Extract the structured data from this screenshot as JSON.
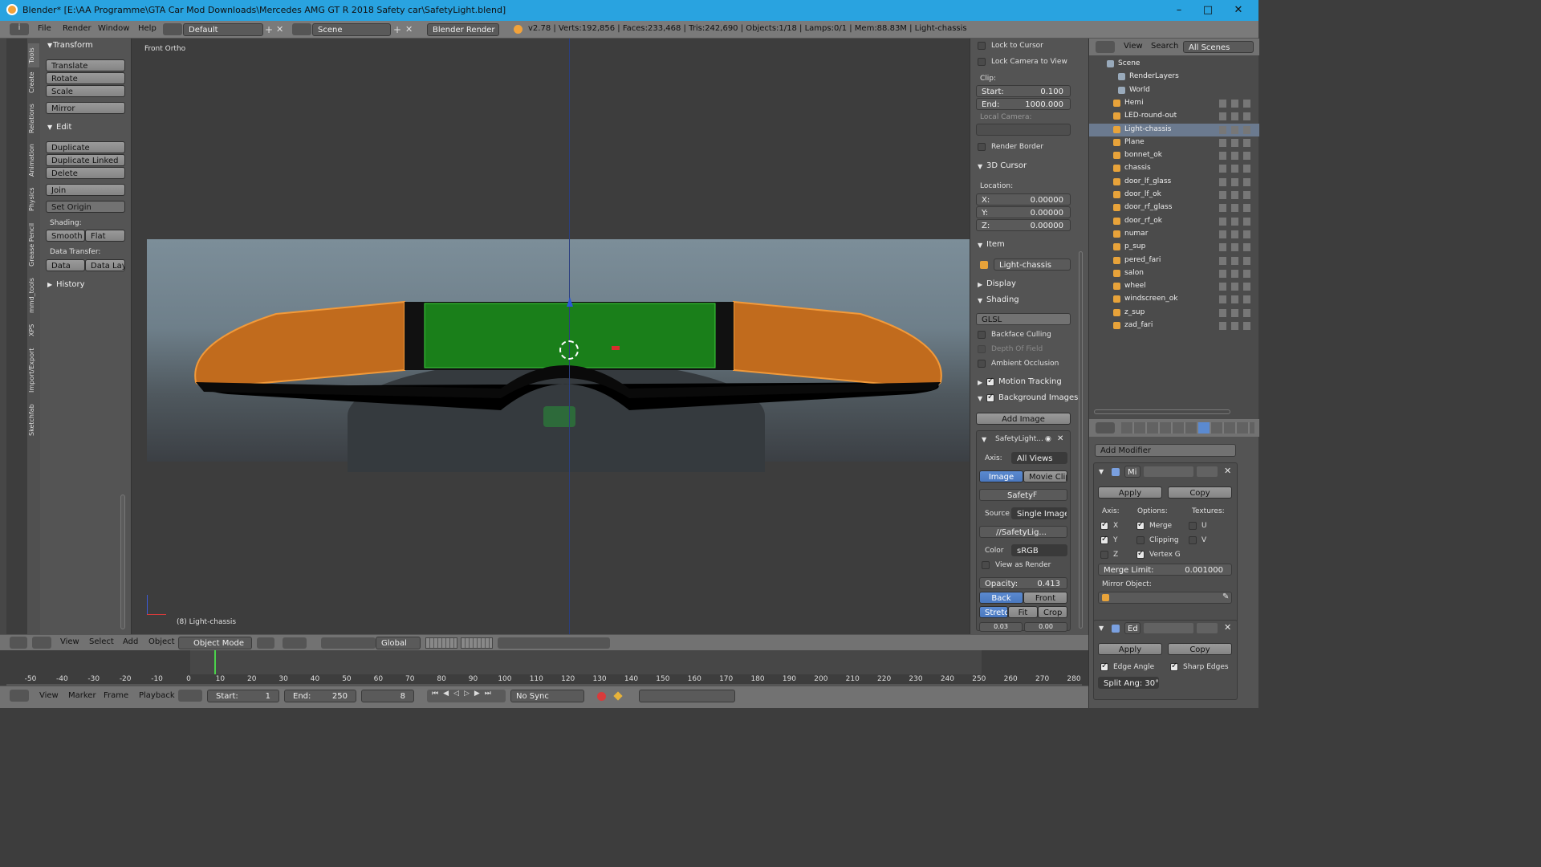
{
  "window": {
    "title": "Blender* [E:\\AA Programme\\GTA Car Mod Downloads\\Mercedes AMG GT R 2018 Safety car\\SafetyLight.blend]",
    "min": "–",
    "max": "□",
    "close": "✕"
  },
  "menubar": {
    "menus": [
      "File",
      "Render",
      "Window",
      "Help"
    ],
    "screen": "Default",
    "scene": "Scene",
    "engine": "Blender Render",
    "stats": "v2.78 | Verts:192,856 | Faces:233,468 | Tris:242,690 | Objects:1/18 | Lamps:0/1 | Mem:88.83M | Light-chassis"
  },
  "tool_tabs": [
    "Tools",
    "Create",
    "Relations",
    "Animation",
    "Physics",
    "Grease Pencil",
    "mmd_tools",
    "XPS",
    "Import/Export",
    "Sketchfab"
  ],
  "tools": {
    "transform_header": "Transform",
    "translate": "Translate",
    "rotate": "Rotate",
    "scale": "Scale",
    "mirror": "Mirror",
    "edit_header": "Edit",
    "duplicate": "Duplicate",
    "duplicate_linked": "Duplicate Linked",
    "delete": "Delete",
    "join": "Join",
    "set_origin": "Set Origin",
    "shading_label": "Shading:",
    "smooth": "Smooth",
    "flat": "Flat",
    "data_transfer_label": "Data Transfer:",
    "data": "Data",
    "data_layout": "Data Layo",
    "history_header": "History"
  },
  "viewport": {
    "view_label": "Front Ortho",
    "object_label": "(8) Light-chassis"
  },
  "view_header": {
    "menus": [
      "View",
      "Select",
      "Add",
      "Object"
    ],
    "mode": "Object Mode",
    "orientation": "Global"
  },
  "npanel": {
    "lock_cursor": "Lock to Cursor",
    "lock_camera": "Lock Camera to View",
    "clip_label": "Clip:",
    "clip_start": "Start:",
    "clip_start_val": "0.100",
    "clip_end": "End:",
    "clip_end_val": "1000.000",
    "local_camera": "Local Camera:",
    "render_border": "Render Border",
    "cursor_header": "3D Cursor",
    "location_label": "Location:",
    "x": "X:",
    "x_val": "0.00000",
    "y": "Y:",
    "y_val": "0.00000",
    "z": "Z:",
    "z_val": "0.00000",
    "item_header": "Item",
    "item_name": "Light-chassis",
    "display_header": "Display",
    "shading_header": "Shading",
    "shading_mode": "GLSL",
    "backface": "Backface Culling",
    "depth_of_field": "Depth Of Field",
    "ambient_occlusion": "Ambient Occlusion",
    "motion_tracking": "Motion Tracking",
    "background_images": "Background Images",
    "add_image": "Add Image",
    "bg_name": "SafetyLight...",
    "axis_label": "Axis:",
    "axis_val": "All Views",
    "image_tab": "Image",
    "movieclip_tab": "Movie Clip",
    "img_name": "Safety",
    "img_f": "F",
    "source_label": "Source",
    "source_val": "Single Image",
    "filepath": "//SafetyLig...",
    "color_label": "Color",
    "color_val": "sRGB",
    "view_as_render": "View as Render",
    "opacity_label": "Opacity:",
    "opacity_val": "0.413",
    "back": "Back",
    "front": "Front",
    "stretch": "Stretch",
    "fit": "Fit",
    "crop": "Crop",
    "off1": "0.03",
    "off2": "0.00"
  },
  "outliner": {
    "view": "View",
    "search": "Search",
    "scenes": "All Scenes",
    "items": [
      "Scene",
      "RenderLayers",
      "World",
      "Hemi",
      "LED-round-out",
      "Light-chassis",
      "Plane",
      "bonnet_ok",
      "chassis",
      "door_lf_glass",
      "door_lf_ok",
      "door_rf_glass",
      "door_rf_ok",
      "numar",
      "p_sup",
      "pered_fari",
      "salon",
      "wheel",
      "windscreen_ok",
      "z_sup",
      "zad_fari"
    ]
  },
  "properties": {
    "add_modifier": "Add Modifier",
    "mod1_name": "Mi",
    "apply": "Apply",
    "copy": "Copy",
    "axis_label": "Axis:",
    "options_label": "Options:",
    "textures_label": "Textures:",
    "x": "X",
    "y": "Y",
    "z": "Z",
    "merge": "Merge",
    "clipping": "Clipping",
    "vertex_g": "Vertex G",
    "u": "U",
    "v": "V",
    "merge_limit": "Merge Limit:",
    "merge_limit_val": "0.001000",
    "mirror_object": "Mirror Object:",
    "mod2_name": "Ed",
    "edge_angle": "Edge Angle",
    "sharp_edges": "Sharp Edges",
    "split_angle": "Split Ang: 30°"
  },
  "timeline": {
    "ticks": [
      "-50",
      "-40",
      "-30",
      "-20",
      "-10",
      "0",
      "10",
      "20",
      "30",
      "40",
      "50",
      "60",
      "70",
      "80",
      "90",
      "100",
      "110",
      "120",
      "130",
      "140",
      "150",
      "160",
      "170",
      "180",
      "190",
      "200",
      "210",
      "220",
      "230",
      "240",
      "250",
      "260",
      "270",
      "280"
    ],
    "menus": [
      "View",
      "Marker",
      "Frame",
      "Playback"
    ],
    "start": "Start:",
    "start_val": "1",
    "end": "End:",
    "end_val": "250",
    "current": "8",
    "sync": "No Sync"
  }
}
